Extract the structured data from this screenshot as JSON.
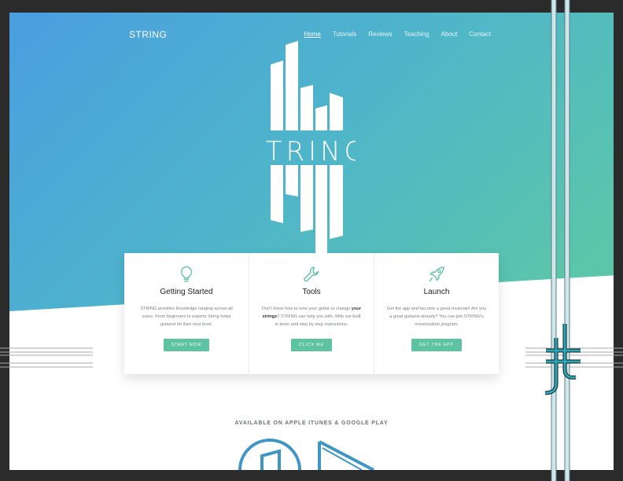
{
  "brand": "STRING",
  "nav": [
    "Home",
    "Tutorials",
    "Reviews",
    "Teaching",
    "About",
    "Contact"
  ],
  "logo_text": "STRING",
  "cards": [
    {
      "icon": "lightbulb-icon",
      "title": "Getting Started",
      "text_before": "STRING provides knowledge ranging across all users. From beginners to experts String helps guitarist hit their next level.",
      "text_bold": "",
      "text_after": "",
      "button": "START NOW"
    },
    {
      "icon": "wrench-icon",
      "title": "Tools",
      "text_before": "Don't know how to tune your guitar or change ",
      "text_bold": "your strings",
      "text_after": "? STRING can help you with. With our built in tuner and step by step instructions.",
      "button": "CLICK ME"
    },
    {
      "icon": "rocket-icon",
      "title": "Launch",
      "text_before": "Get the app and become a great musician! Are you a great guitarist already? You can join STRING's monetization program.",
      "text_bold": "",
      "text_after": "",
      "button": "GET THE APP"
    }
  ],
  "available_text": "AVAILABLE ON APPLE ITUNES & GOOGLE PLAY",
  "colors": {
    "accent": "#5ec3a0",
    "gradient_start": "#4a9ee0",
    "gradient_end": "#5ec9a4",
    "line_teal": "#2aa7b8"
  }
}
